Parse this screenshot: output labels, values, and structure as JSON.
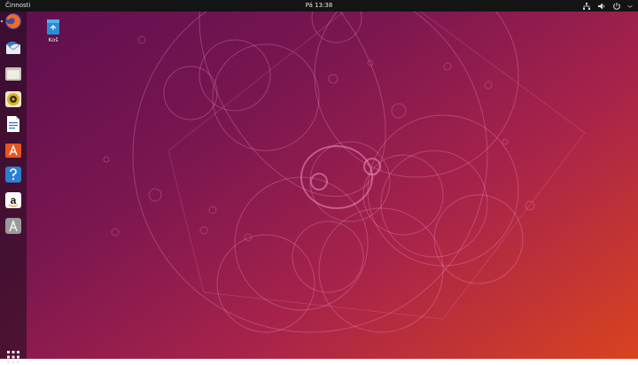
{
  "topbar": {
    "activities_label": "Činnosti",
    "clock": "Pá 13:38",
    "tray": [
      {
        "icon": "network-icon"
      },
      {
        "icon": "volume-icon"
      },
      {
        "icon": "power-icon"
      },
      {
        "icon": "chevron-down-icon"
      }
    ]
  },
  "dock": {
    "items": [
      {
        "name": "Firefox",
        "icon": "firefox-icon",
        "color": "#f46a22",
        "running": true
      },
      {
        "name": "Thunderbird",
        "icon": "thunderbird-icon",
        "color": "#3f78c6",
        "running": false
      },
      {
        "name": "Files",
        "icon": "files-icon",
        "color": "#c9c2b8",
        "running": false
      },
      {
        "name": "Rhythmbox",
        "icon": "rhythmbox-icon",
        "color": "#e2b21a",
        "running": false
      },
      {
        "name": "LibreOffice Writer",
        "icon": "writer-icon",
        "color": "#1f73c9",
        "running": false
      },
      {
        "name": "Ubuntu Software",
        "icon": "software-center-icon",
        "color": "#e95420",
        "running": false
      },
      {
        "name": "Help",
        "icon": "help-icon",
        "color": "#2a7fd4",
        "running": false
      },
      {
        "name": "Amazon",
        "icon": "amazon-icon",
        "color": "#ffffff",
        "running": false
      },
      {
        "name": "Software Updater",
        "icon": "updater-icon",
        "color": "#9a9a9a",
        "running": false
      }
    ],
    "show_apps_icon": "grid-icon"
  },
  "desktop": {
    "icons": [
      {
        "label": "Koš",
        "icon": "trash-icon"
      }
    ]
  },
  "colors": {
    "accent": "#e95420",
    "topbar": "#141414",
    "wallpaper_start": "#5c0f4e",
    "wallpaper_end": "#d9431f"
  }
}
